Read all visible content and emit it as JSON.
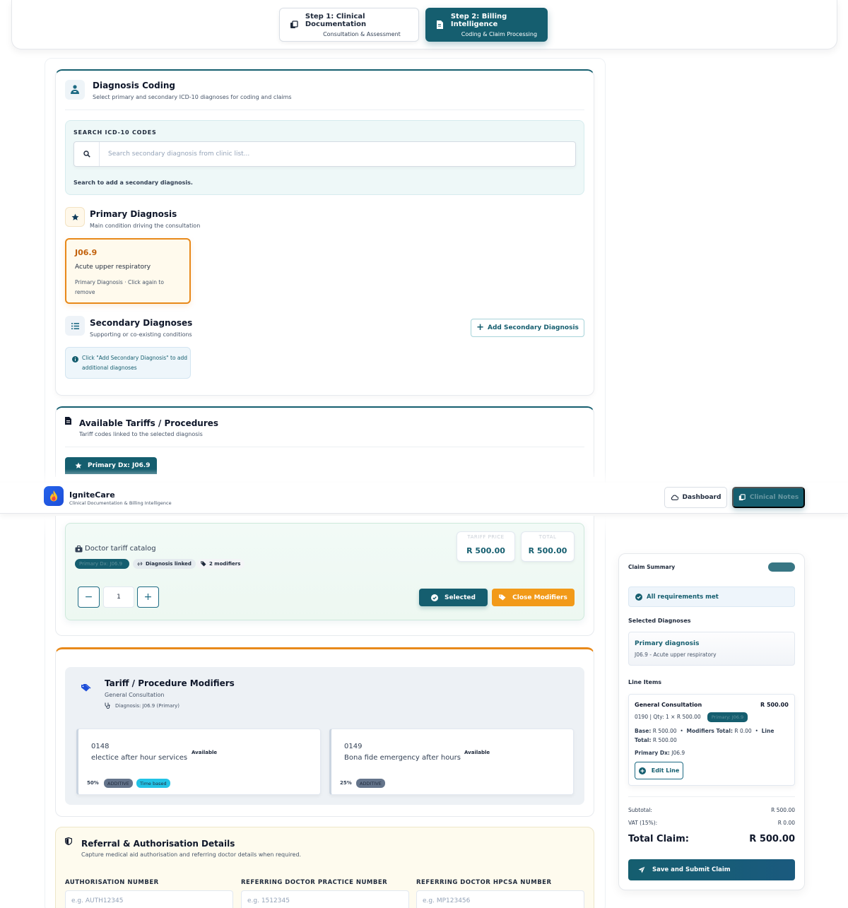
{
  "stepper": {
    "step1": {
      "title": "Step 1: Clinical Documentation",
      "subtitle": "Consultation & Assessment"
    },
    "step2": {
      "title": "Step 2: Billing Intelligence",
      "subtitle": "Coding & Claim Processing"
    }
  },
  "navbar": {
    "brand": "IgniteCare",
    "tagline": "Clinical Documentation & Billing Intelligence",
    "dashboard_label": "Dashboard",
    "clinical_label": "Clinical Notes"
  },
  "diagnosis": {
    "title": "Diagnosis Coding",
    "subtitle": "Select primary and secondary ICD-10 diagnoses for coding and claims",
    "search_label": "SEARCH ICD-10 CODES",
    "search_placeholder": "Search secondary diagnosis from clinic list...",
    "search_hint": "Search to add a secondary diagnosis.",
    "primary_title": "Primary Diagnosis",
    "primary_subtitle": "Main condition driving the consultation",
    "primary_code": "J06.9",
    "primary_name": "Acute upper respiratory",
    "primary_note": "Primary Diagnosis · Click again to remove",
    "secondary_title": "Secondary Diagnoses",
    "secondary_subtitle": "Supporting or co-existing conditions",
    "add_secondary_label": "Add Secondary Diagnosis",
    "secondary_info": "Click \"Add Secondary Diagnosis\" to add additional diagnoses"
  },
  "tariffs": {
    "title": "Available Tariffs / Procedures",
    "subtitle": "Tariff codes linked to the selected diagnosis",
    "primary_pill": "Primary Dx: J06.9",
    "catalog_label": "Doctor tariff catalog",
    "tag_primary": "Primary Dx: J06.9",
    "tag_linked": "Diagnosis linked",
    "tag_modifiers": "2 modifiers",
    "price_label": "TARIFF PRICE",
    "price_value": "R 500.00",
    "total_label": "TOTAL",
    "total_value": "R 500.00",
    "quantity": "1",
    "minus": "−",
    "plus": "+",
    "selected_label": "Selected",
    "close_modifiers_label": "Close Modifiers"
  },
  "modifiers": {
    "title": "Tariff / Procedure Modifiers",
    "subtitle": "General Consultation",
    "diagnosis_line": "Diagnosis: J06.9 (Primary)",
    "items": [
      {
        "code": "0148",
        "name": "electice after hour services",
        "status": "Available",
        "pct": "50%",
        "type": "ADDITIVE",
        "extra": "Time based"
      },
      {
        "code": "0149",
        "name": "Bona fide emergency after hours",
        "status": "Available",
        "pct": "25%",
        "type": "ADDITIVE"
      }
    ]
  },
  "referral": {
    "title": "Referral & Authorisation Details",
    "subtitle": "Capture medical aid authorisation and referring doctor details when required.",
    "fields": [
      {
        "label": "AUTHORISATION NUMBER",
        "placeholder": "e.g. AUTH12345"
      },
      {
        "label": "REFERRING DOCTOR PRACTICE NUMBER",
        "placeholder": "e.g. 1512345"
      },
      {
        "label": "REFERRING DOCTOR HPCSA NUMBER",
        "placeholder": "e.g. MP123456"
      }
    ]
  },
  "summary": {
    "title": "Claim Summary",
    "requirements": "All requirements met",
    "selected_dx_label": "Selected Diagnoses",
    "primary_label": "Primary diagnosis",
    "primary_value": "J06.9 - Acute upper respiratory",
    "line_items_label": "Line Items",
    "line_name": "General Consultation",
    "line_amount": "R 500.00",
    "line_detail": "0190 | Qty: 1 × R 500.00",
    "line_tag": "Primary: J06.9",
    "base_label": "Base:",
    "base_value": "R 500.00",
    "mod_total_label": "Modifiers Total:",
    "mod_total_value": "R 0.00",
    "line_total_label": "Line Total:",
    "line_total_value": "R 500.00",
    "primary_dx_label": "Primary Dx:",
    "primary_dx_value": "J06.9",
    "edit_label": "Edit Line",
    "subtotal_label": "Subtotal:",
    "subtotal_value": "R 500.00",
    "vat_label": "VAT (15%):",
    "vat_value": "R 0.00",
    "total_label": "Total Claim:",
    "total_value": "R 500.00",
    "submit_label": "Save and Submit Claim"
  },
  "colors": {
    "primary": "#155e6f",
    "accent": "#e8891a",
    "brand": "#2563eb"
  }
}
